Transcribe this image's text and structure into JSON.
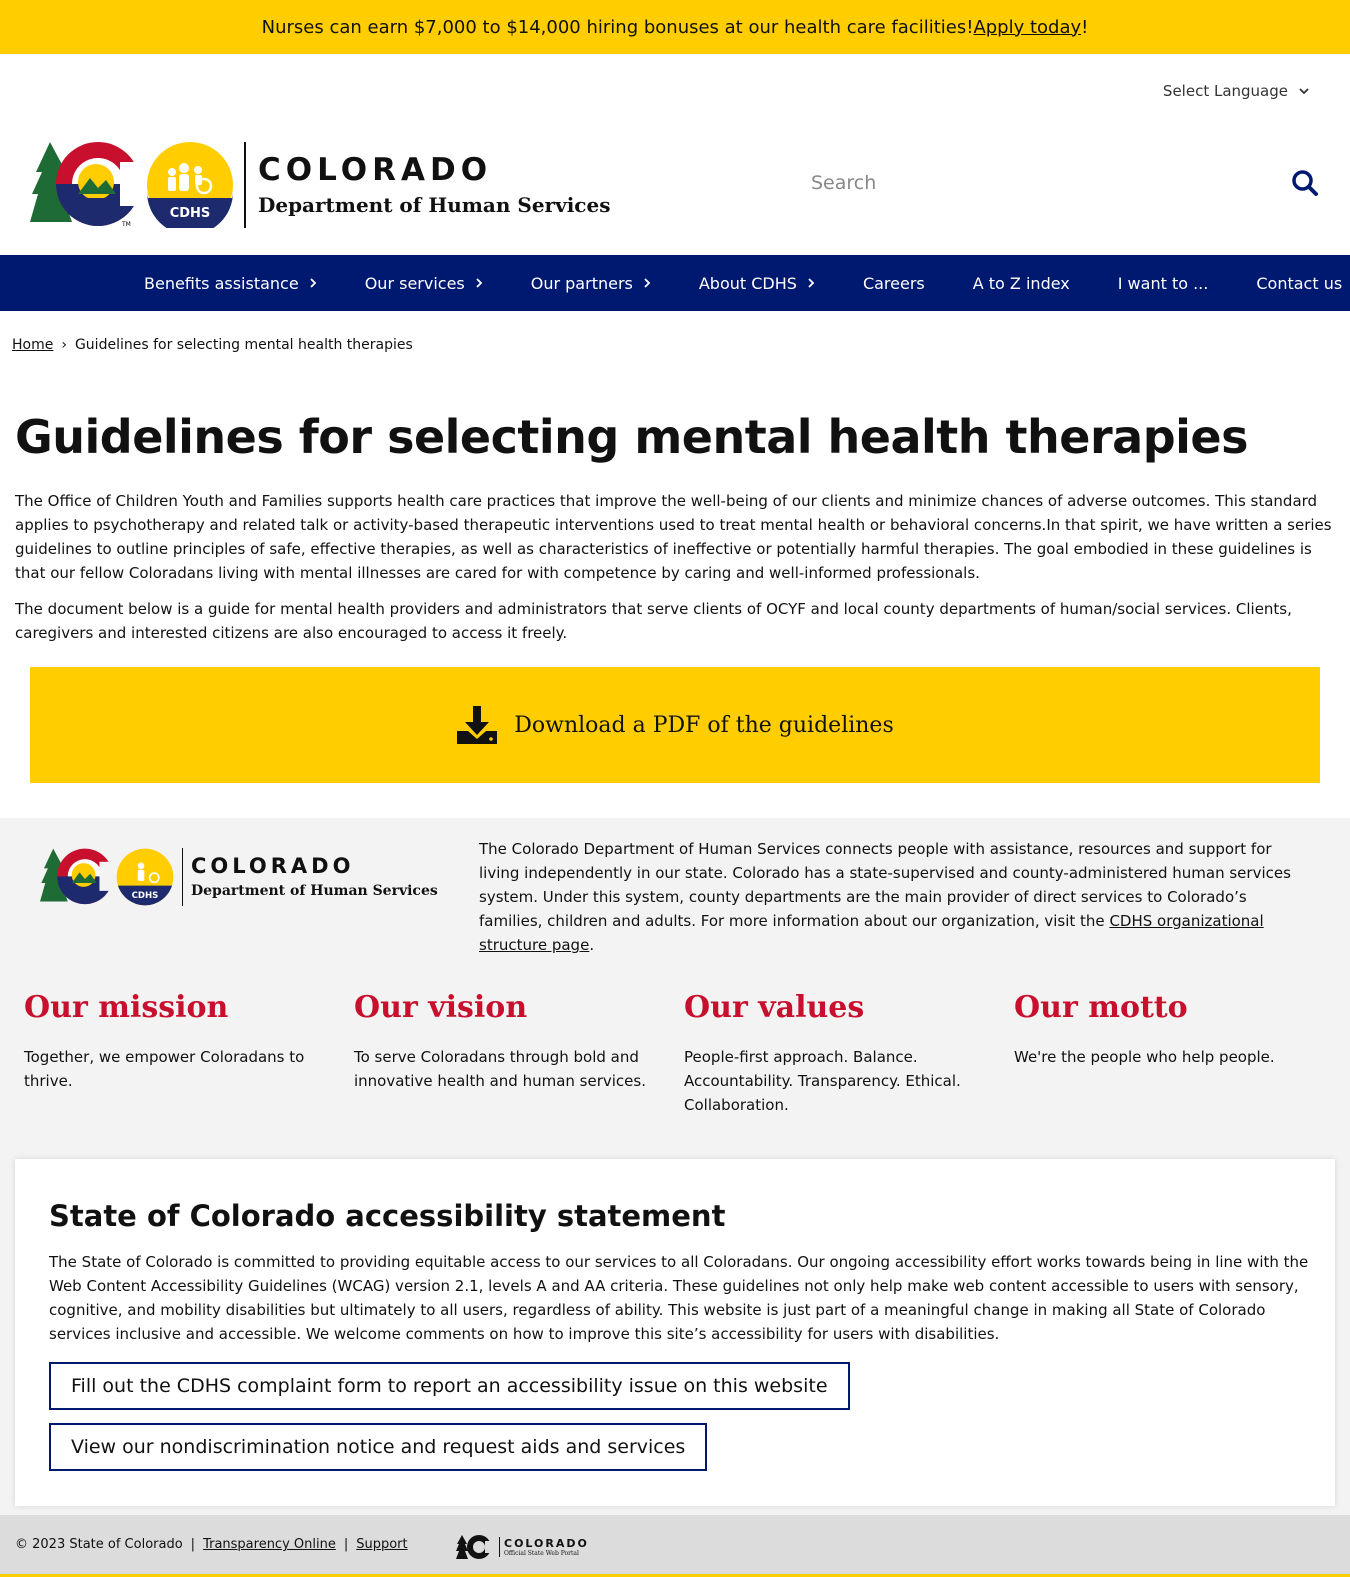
{
  "announcement": {
    "text": "Nurses can earn $7,000 to $14,000 hiring bonuses at our health care facilities! ",
    "link": "Apply today",
    "suffix": "!"
  },
  "header": {
    "language": "Select Language",
    "logo_line1": "COLORADO",
    "logo_line2": "Department of Human Services",
    "logo_badge": "CDHS",
    "logo_tm": "TM",
    "search_placeholder": "Search"
  },
  "nav": {
    "items": [
      {
        "label": "Benefits assistance",
        "has_children": true
      },
      {
        "label": "Our services",
        "has_children": true
      },
      {
        "label": "Our partners",
        "has_children": true
      },
      {
        "label": "About CDHS",
        "has_children": true
      },
      {
        "label": "Careers",
        "has_children": false
      },
      {
        "label": "A to Z index",
        "has_children": false
      },
      {
        "label": "I want to ...",
        "has_children": false
      },
      {
        "label": "Contact us",
        "has_children": false
      }
    ]
  },
  "breadcrumb": {
    "home": "Home",
    "separator": "›",
    "current": "Guidelines for selecting mental health therapies"
  },
  "main": {
    "title": "Guidelines for selecting mental health therapies",
    "paragraph1": "The Office of Children Youth and Families supports health care practices that improve the well-being of our clients and minimize chances of adverse outcomes. This standard applies to psychotherapy and related talk or activity-based therapeutic interventions used to treat mental health or behavioral concerns.In that spirit, we have written a series guidelines to outline principles of safe, effective therapies, as well as characteristics of ineffective or potentially harmful therapies. The goal embodied in these guidelines is that our fellow Coloradans living with mental illnesses are cared for with competence by caring and well-informed professionals.",
    "paragraph2": "The document below is a guide for mental health providers and administrators that serve clients of OCYF and local county departments of human/social services. Clients, caregivers and interested citizens are also encouraged to access it freely.",
    "download_label": "Download a PDF of the guidelines"
  },
  "footer": {
    "logo_line1": "COLORADO",
    "logo_line2": "Department of Human Services",
    "about_text": "The Colorado Department of Human Services connects people with assistance, resources and support for living independently in our state. Colorado has a state-supervised and county-administered human services system. Under this system, county departments are the main provider of direct services to Colorado’s families, children and adults. For more information about our organization, visit the ",
    "about_link": "CDHS organizational structure page",
    "about_suffix": ".",
    "pillars": [
      {
        "title": "Our mission",
        "text": "Together, we empower Coloradans to thrive."
      },
      {
        "title": "Our vision",
        "text": "To serve Coloradans through bold and innovative health and human services."
      },
      {
        "title": "Our values",
        "text": "People-first approach. Balance. Accountability. Transparency. Ethical. Collaboration."
      },
      {
        "title": "Our motto",
        "text": "We're the people who help people."
      }
    ]
  },
  "accessibility": {
    "title": "State of Colorado accessibility statement",
    "text": "The State of Colorado is committed to providing equitable access to our services to all Coloradans. Our ongoing accessibility effort works towards being in line with the Web Content Accessibility Guidelines (WCAG) version 2.1, levels A and AA criteria. These guidelines not only help make web content accessible to users with sensory, cognitive, and mobility disabilities but ultimately to all users, regardless of ability. This website is just part of a meaningful change in making all State of Colorado services inclusive and accessible. We welcome comments on how to improve this site’s accessibility for users with disabilities.",
    "button1": "Fill out the CDHS complaint form to report an accessibility issue on this website",
    "button2": "View our nondiscrimination notice and request aids and services"
  },
  "bottom": {
    "copyright": "© 2023 State of Colorado",
    "sep": "|",
    "transparency": "Transparency Online",
    "support": "Support",
    "portal_line1": "COLORADO",
    "portal_line2": "Official State Web Portal"
  },
  "colors": {
    "yellow": "#ffcd00",
    "navy": "#001970",
    "red": "#c8102e",
    "gray_band": "#f3f3f3"
  }
}
